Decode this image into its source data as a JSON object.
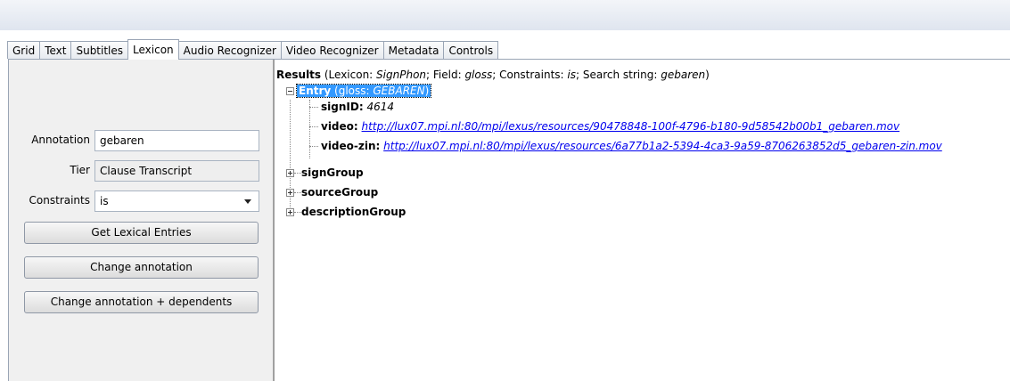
{
  "tabs": [
    "Grid",
    "Text",
    "Subtitles",
    "Lexicon",
    "Audio Recognizer",
    "Video Recognizer",
    "Metadata",
    "Controls"
  ],
  "active_tab": "Lexicon",
  "form": {
    "annotation_label": "Annotation",
    "annotation_value": "gebaren",
    "tier_label": "Tier",
    "tier_value": "Clause Transcript",
    "constraints_label": "Constraints",
    "constraints_value": "is"
  },
  "buttons": {
    "get_lexical": "Get Lexical Entries",
    "change_annotation": "Change annotation",
    "change_dependents": "Change annotation + dependents"
  },
  "results": {
    "heading": "Results",
    "paren_open": " (Lexicon: ",
    "lexicon": "SignPhon",
    "field_prefix": "; Field: ",
    "field": "gloss",
    "constraints_prefix": "; Constraints: ",
    "constraints": "is",
    "search_prefix": "; Search string: ",
    "search_string": "gebaren",
    "paren_close": ")",
    "entry_label": "Entry",
    "entry_paren_open": " (gloss: ",
    "entry_gloss": "GEBAREN",
    "entry_paren_close": ")",
    "signid_key": "signID:",
    "signid_value": "4614",
    "video_key": "video:",
    "video_url": "http://lux07.mpi.nl:80/mpi/lexus/resources/90478848-100f-4796-b180-9d58542b00b1_gebaren.mov",
    "videozin_key": "video-zin:",
    "videozin_url": "http://lux07.mpi.nl:80/mpi/lexus/resources/6a77b1a2-5394-4ca3-9a59-8706263852d5_gebaren-zin.mov",
    "groups": [
      "signGroup",
      "sourceGroup",
      "descriptionGroup"
    ]
  }
}
